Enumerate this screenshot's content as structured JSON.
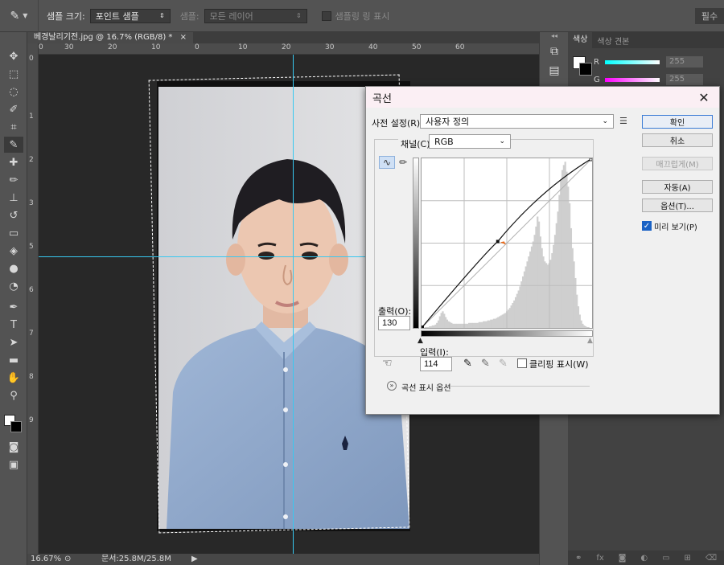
{
  "options_bar": {
    "sample_size_label": "샘플 크기:",
    "sample_size_value": "포인트 샘플",
    "sample_label": "샘플:",
    "sample_value": "모든 레이어",
    "show_ring_label": "샘플링 링 표시",
    "right_button": "필수"
  },
  "document": {
    "tab_title": "베경날리기전.jpg @ 16.7% (RGB/8) *",
    "ruler_top": [
      "0",
      "30",
      "20",
      "10",
      "0",
      "10",
      "20",
      "30",
      "40",
      "50",
      "60"
    ],
    "ruler_left": [
      "0",
      "1",
      "2",
      "3",
      "4",
      "5",
      "6",
      "7",
      "8",
      "9"
    ]
  },
  "status": {
    "zoom": "16.67%",
    "doc_size": "문서:25.8M/25.8M"
  },
  "color_panel": {
    "tab_color": "색상",
    "tab_swatches": "색상 견본",
    "r_label": "R",
    "r_value": "255",
    "g_label": "G",
    "g_value": "255"
  },
  "curves_dialog": {
    "title": "곡선",
    "preset_label": "사전 설정(R):",
    "preset_value": "사용자 정의",
    "channel_label": "채널(C):",
    "channel_value": "RGB",
    "output_label": "출력(O):",
    "output_value": "130",
    "input_label": "입력(I):",
    "input_value": "114",
    "clipping_label": "클리핑 표시(W)",
    "display_options": "곡선 표시 옵션",
    "buttons": {
      "ok": "확인",
      "cancel": "취소",
      "smooth": "매끄럽게(M)",
      "auto": "자동(A)",
      "options": "옵션(T)...",
      "preview": "미리 보기(P)"
    },
    "curve_input": 114,
    "curve_output": 130,
    "histogram": [
      0,
      0,
      1,
      1,
      1,
      2,
      2,
      3,
      3,
      4,
      6,
      9,
      14,
      18,
      20,
      17,
      13,
      10,
      8,
      7,
      6,
      5,
      5,
      5,
      5,
      5,
      5,
      5,
      5,
      5,
      5,
      5,
      6,
      6,
      6,
      6,
      6,
      6,
      6,
      7,
      7,
      7,
      8,
      8,
      8,
      9,
      9,
      10,
      10,
      11,
      11,
      12,
      13,
      14,
      15,
      16,
      17,
      18,
      20,
      22,
      24,
      27,
      30,
      33,
      37,
      41,
      45,
      50,
      56,
      62,
      68,
      74,
      80,
      86,
      92,
      98,
      104,
      112,
      122,
      134,
      128,
      110,
      96,
      86,
      80,
      78,
      76,
      78,
      82,
      90,
      100,
      112,
      126,
      140,
      160,
      178,
      190,
      196,
      200,
      188,
      170,
      150,
      120,
      96,
      80,
      60,
      40,
      26,
      16,
      9,
      5,
      3,
      2,
      1,
      1,
      0,
      0
    ]
  },
  "colors": {
    "accent_blue": "#1a62c5",
    "guide": "#38c8f0"
  }
}
